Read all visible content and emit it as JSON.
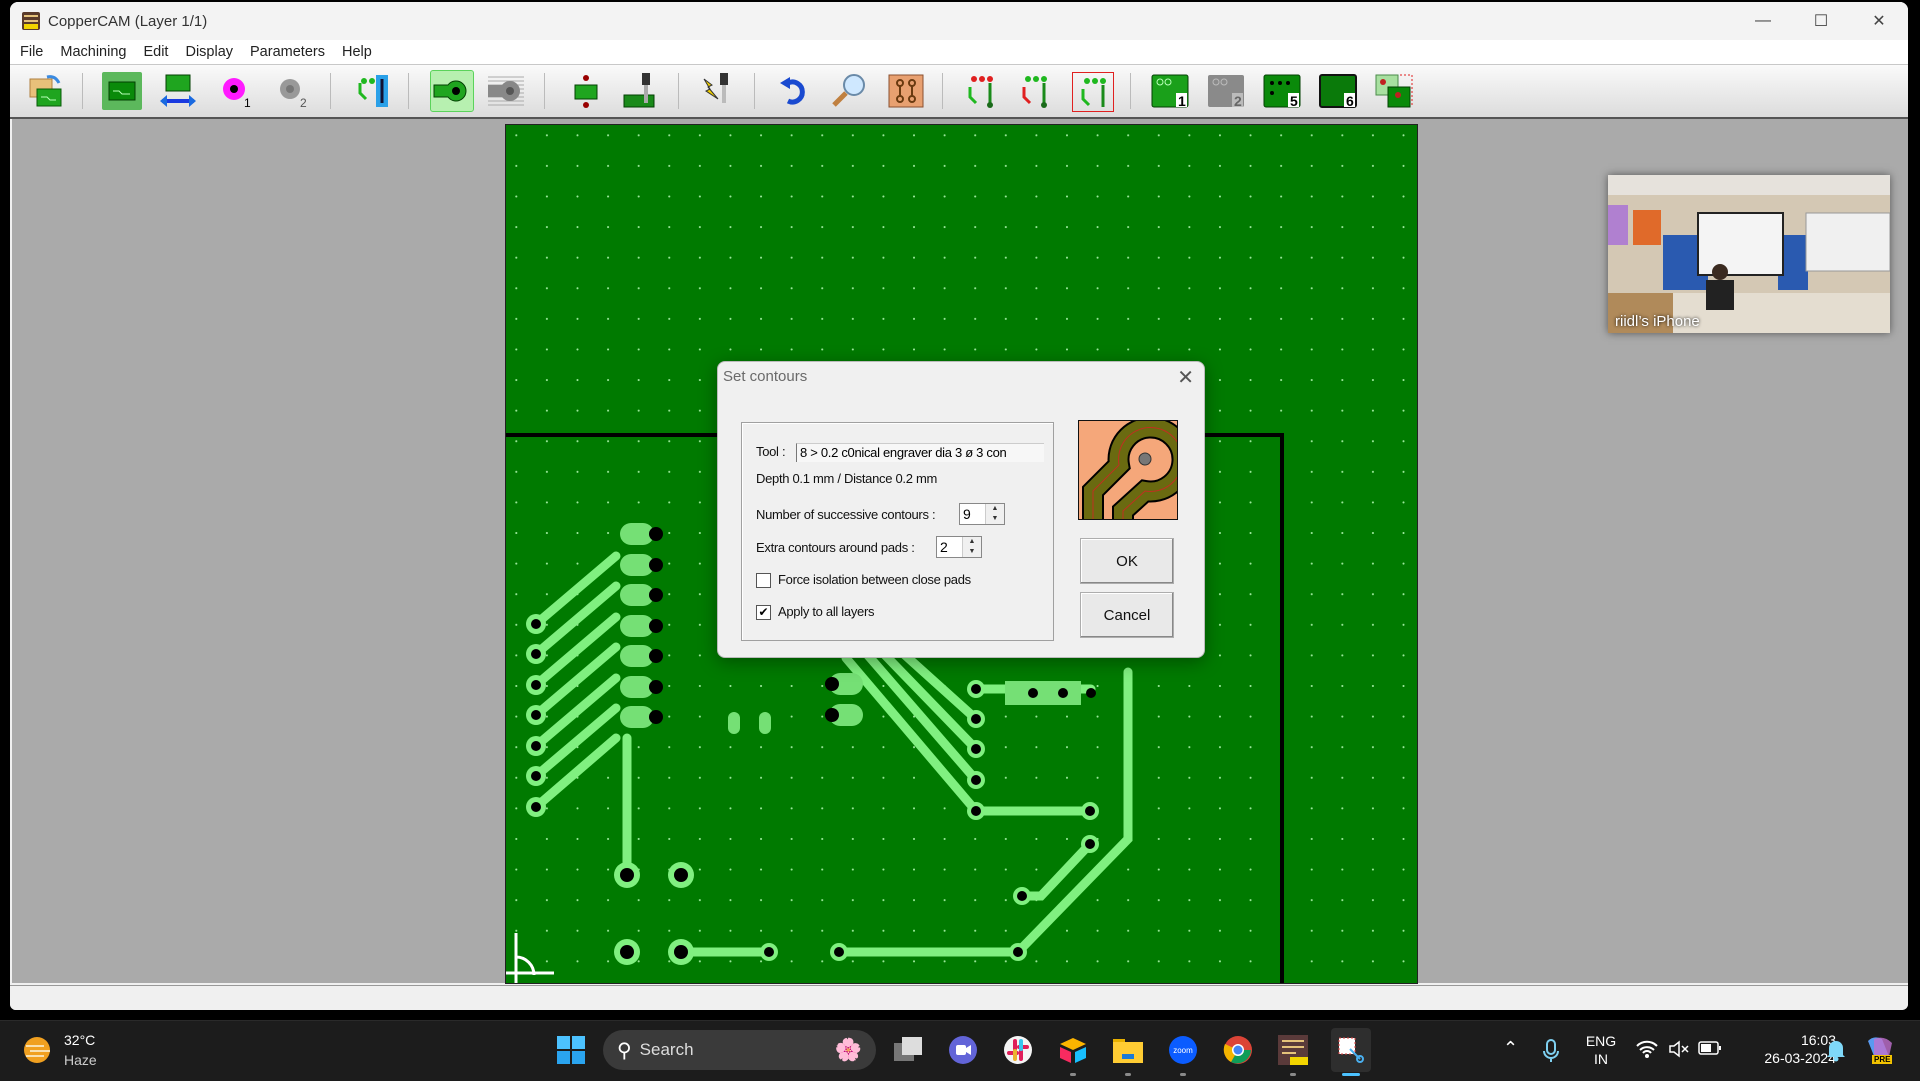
{
  "window": {
    "title": "CopperCAM   (Layer 1/1)",
    "controls": [
      "minimize",
      "maximize",
      "close"
    ]
  },
  "menu": [
    {
      "label": "File",
      "accel": "F"
    },
    {
      "label": "Machining",
      "accel": "M"
    },
    {
      "label": "Edit",
      "accel": "E"
    },
    {
      "label": "Display",
      "accel": "D"
    },
    {
      "label": "Parameters",
      "accel": "P"
    },
    {
      "label": "Help",
      "accel": "H"
    }
  ],
  "toolbar": {
    "buttons": [
      {
        "name": "open-file",
        "icon": "folder-open-pcb-icon"
      },
      {
        "name": "new-board",
        "icon": "pcb-board-icon",
        "active": false
      },
      {
        "name": "board-dimensions",
        "icon": "pcb-width-arrow-icon"
      },
      {
        "name": "drill-1",
        "icon": "magenta-pad-icon",
        "badge": "1"
      },
      {
        "name": "drill-2",
        "icon": "gray-pad-icon",
        "badge": "2"
      },
      {
        "name": "tracks",
        "icon": "tracks-icon"
      },
      {
        "name": "set-contours",
        "icon": "contour-pad-icon",
        "active": true
      },
      {
        "name": "hatching",
        "icon": "hatched-pad-icon"
      },
      {
        "name": "drill-board",
        "icon": "board-drill-point-icon"
      },
      {
        "name": "mill-tool",
        "icon": "mill-tool-icon"
      },
      {
        "name": "engrave-tool",
        "icon": "lightning-tool-icon"
      },
      {
        "name": "undo",
        "icon": "undo-icon"
      },
      {
        "name": "zoom",
        "icon": "magnifier-icon"
      },
      {
        "name": "copper-view",
        "icon": "copper-pcb-icon"
      },
      {
        "name": "select-pads",
        "icon": "red-pads-icon"
      },
      {
        "name": "select-tracks",
        "icon": "red-tracks-icon"
      },
      {
        "name": "select-all",
        "icon": "framed-tracks-icon"
      },
      {
        "name": "layer-1",
        "icon": "layer-tracks-icon",
        "badge": "1"
      },
      {
        "name": "layer-2",
        "icon": "layer-tracks-gray-icon",
        "badge": "2"
      },
      {
        "name": "layer-5",
        "icon": "layer-drills-icon",
        "badge": "5"
      },
      {
        "name": "layer-6",
        "icon": "layer-outline-icon",
        "badge": "6"
      },
      {
        "name": "layers-overlay",
        "icon": "layers-overlay-icon"
      }
    ]
  },
  "dialog": {
    "title": "Set contours",
    "tool_label": "Tool :",
    "tool_value": "8 > 0.2 c0nical engraver dia 3   ø 3   con",
    "depth_distance": "Depth 0.1 mm  /  Distance 0.2 mm",
    "successive_contours_label": "Number of successive contours :",
    "successive_contours_value": "9",
    "extra_contours_label": "Extra contours around pads :",
    "extra_contours_value": "2",
    "force_isolation_label": "Force isolation between close pads",
    "force_isolation_checked": false,
    "apply_all_label": "Apply to all layers",
    "apply_all_checked": true,
    "ok_label": "OK",
    "cancel_label": "Cancel",
    "check_mark": "✔"
  },
  "camera_overlay": {
    "label": "riidl’s iPhone"
  },
  "taskbar": {
    "weather_temp": "32°C",
    "weather_desc": "Haze",
    "search_placeholder": "Search",
    "apps": [
      "task-view",
      "teams-meet",
      "slack",
      "airtable",
      "file-explorer",
      "zoom",
      "chrome",
      "coppercam",
      "snipping-tool"
    ],
    "zoom_label": "zoom",
    "lang_top": "ENG",
    "lang_bottom": "IN",
    "time": "16:03",
    "date": "26-03-2024",
    "copilot_badge": "PRE"
  },
  "colors": {
    "board_green": "#007a00",
    "trace_green": "#80f080",
    "pad_hole": "#000000",
    "preview_copper": "#f5a77a",
    "active_tool": "#b7f0b0"
  }
}
